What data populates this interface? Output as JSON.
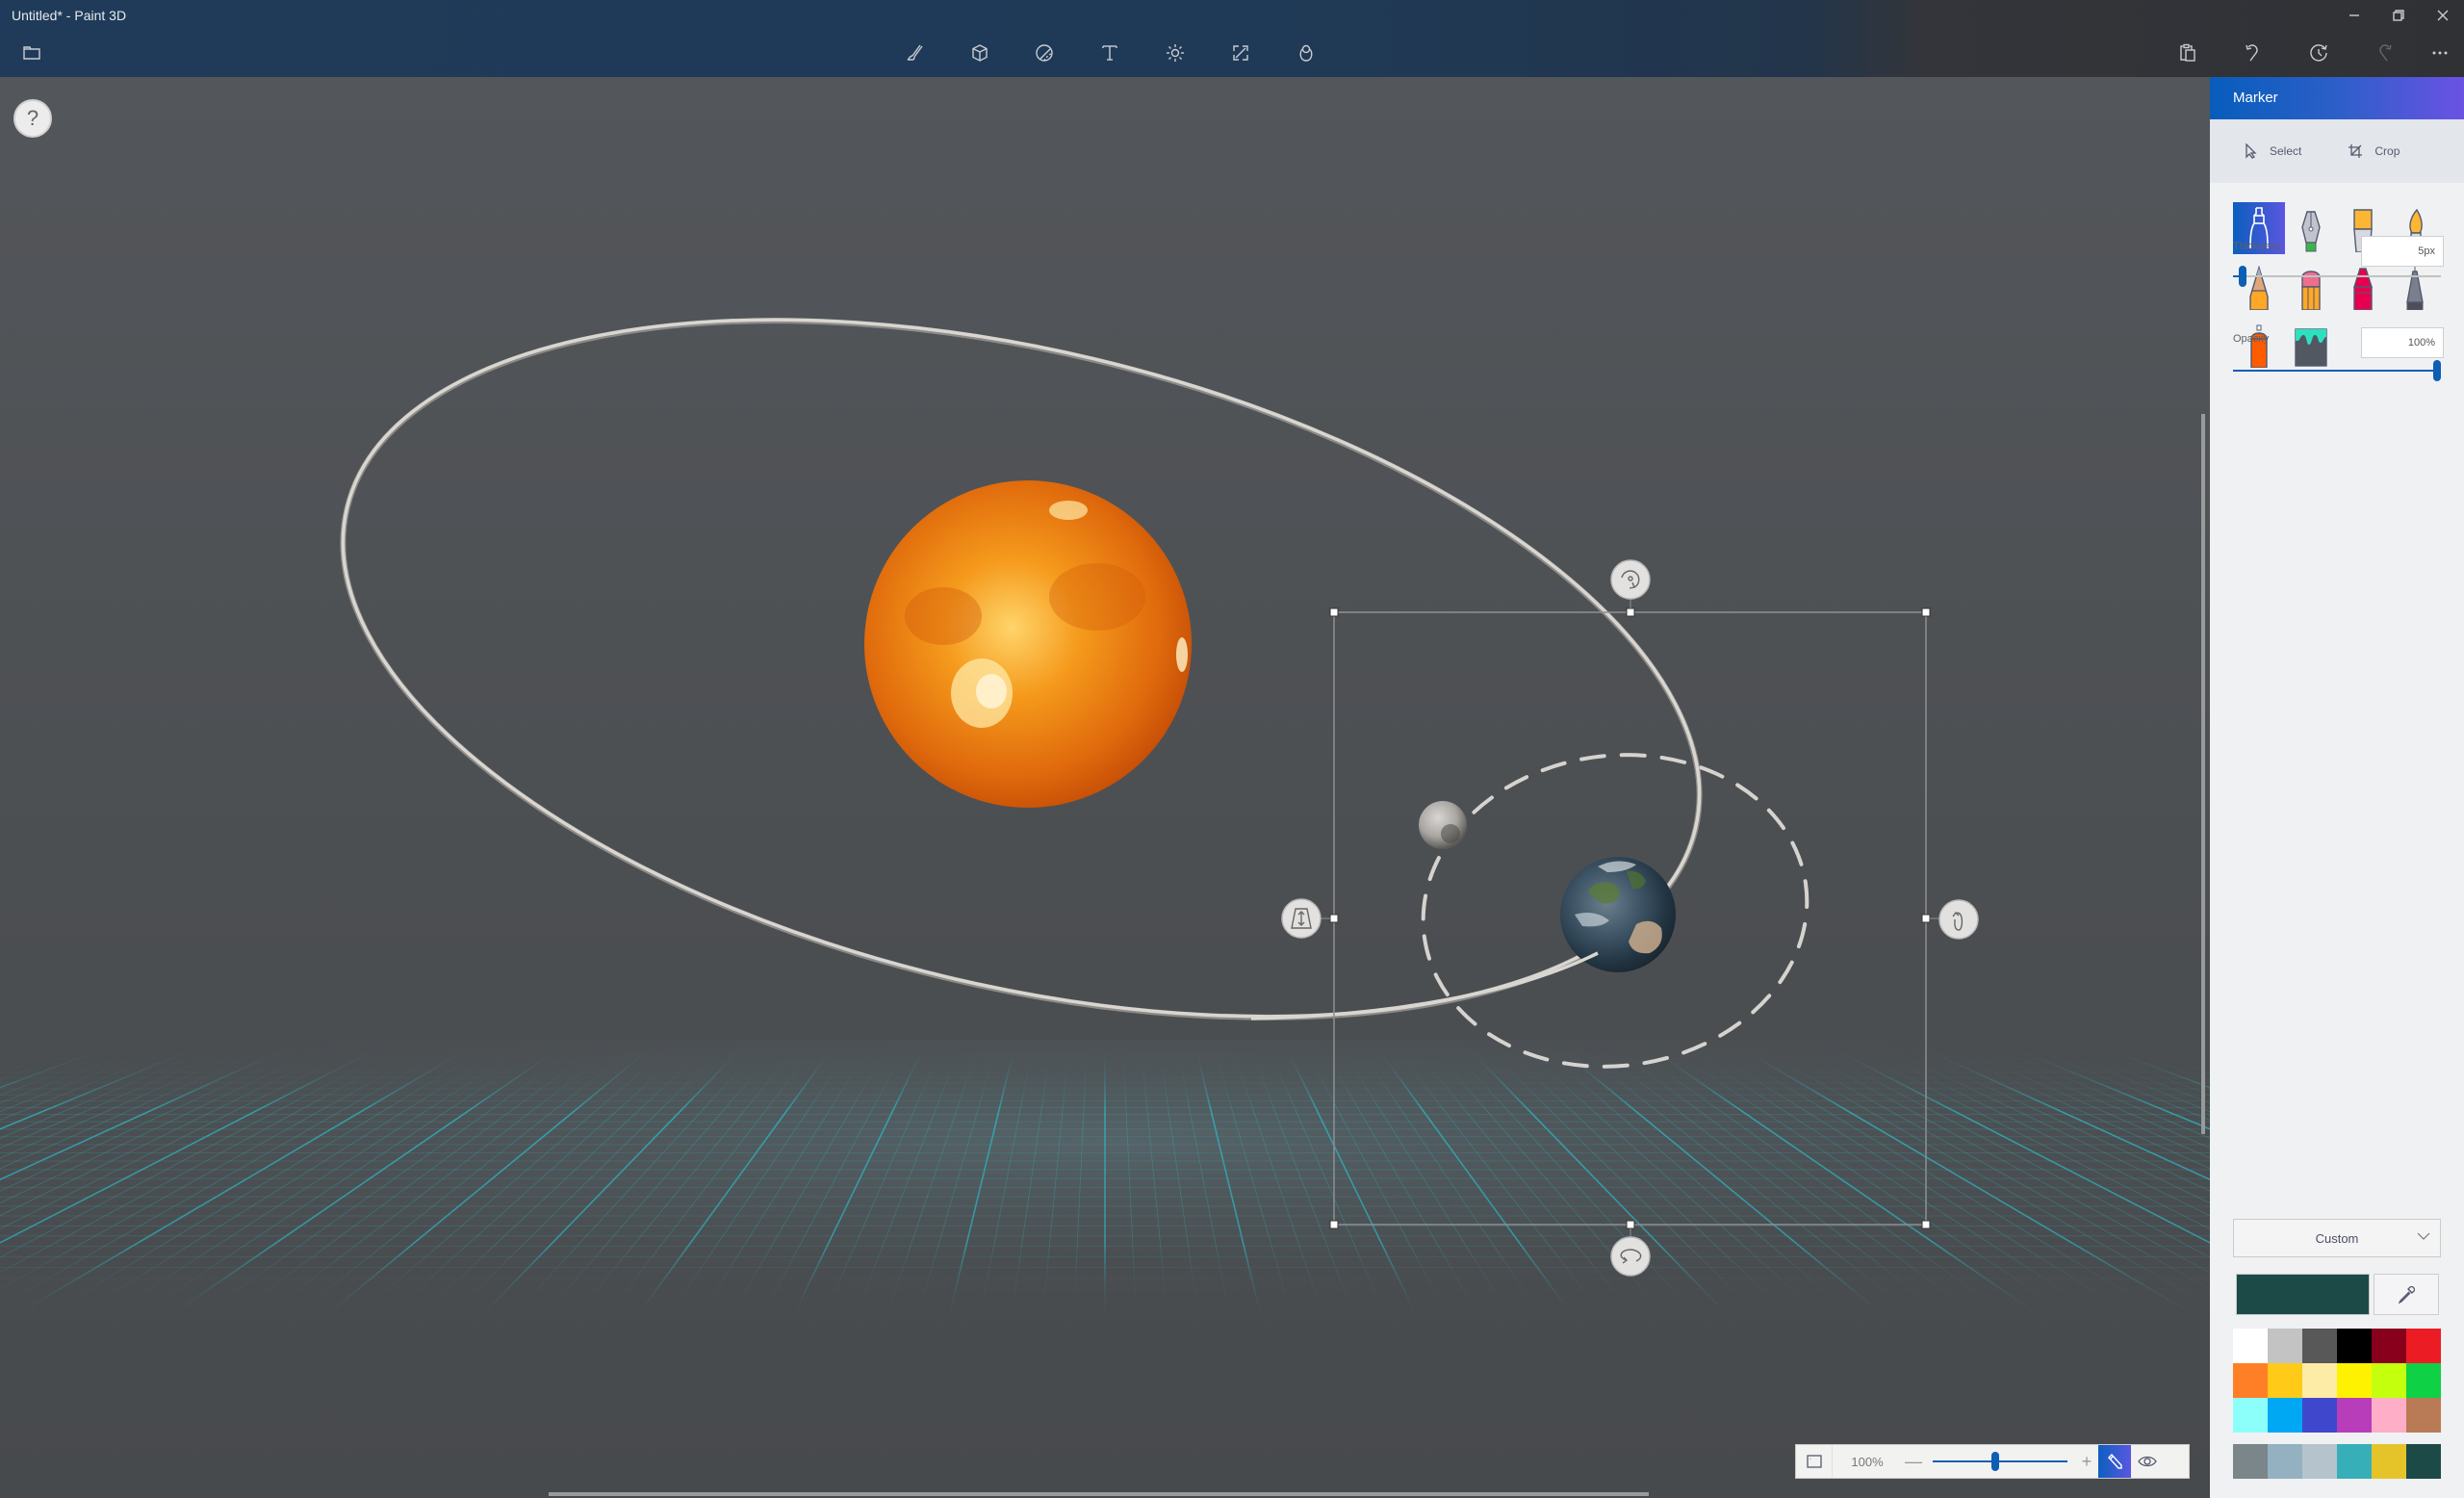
{
  "window": {
    "title": "Untitled* - Paint 3D",
    "controls": [
      "minimize",
      "restore",
      "close"
    ]
  },
  "toolbar": {
    "left": [
      {
        "name": "menu",
        "icon": "folder-icon"
      }
    ],
    "center": [
      {
        "name": "brushes",
        "icon": "brush-icon"
      },
      {
        "name": "3d-shapes",
        "icon": "cube-icon"
      },
      {
        "name": "stickers",
        "icon": "sticker-icon"
      },
      {
        "name": "text",
        "icon": "text-icon"
      },
      {
        "name": "effects",
        "icon": "effects-icon"
      },
      {
        "name": "canvas",
        "icon": "canvas-icon"
      },
      {
        "name": "3d-library",
        "icon": "3d-library-icon"
      }
    ],
    "right": [
      {
        "name": "paste",
        "icon": "paste-icon",
        "enabled": true
      },
      {
        "name": "undo",
        "icon": "undo-icon",
        "enabled": true
      },
      {
        "name": "history",
        "icon": "history-icon",
        "enabled": true
      },
      {
        "name": "redo",
        "icon": "redo-icon",
        "enabled": false
      },
      {
        "name": "more",
        "icon": "more-icon",
        "enabled": true
      }
    ]
  },
  "canvas": {
    "help_label": "?",
    "objects": [
      "sun",
      "earth",
      "moon",
      "earth-orbit",
      "moon-orbit"
    ],
    "selection_handles": [
      "rotate-z",
      "tilt",
      "rotate-y",
      "rotate-x"
    ]
  },
  "zoom_bar": {
    "zoom_label": "100%",
    "zoom_fraction": 0.46,
    "minus": "—",
    "plus": "+",
    "modes": [
      "edit",
      "view"
    ],
    "active_mode": "edit"
  },
  "panel": {
    "title": "Marker",
    "select_label": "Select",
    "crop_label": "Crop",
    "tools": [
      {
        "name": "marker",
        "selected": true
      },
      {
        "name": "calligraphy-pen",
        "selected": false
      },
      {
        "name": "oil-brush",
        "selected": false
      },
      {
        "name": "watercolor",
        "selected": false
      },
      {
        "name": "pixel-pen",
        "selected": false
      },
      {
        "name": "pencil",
        "selected": false
      },
      {
        "name": "eraser",
        "selected": false
      },
      {
        "name": "crayon",
        "selected": false
      },
      {
        "name": "spray-can",
        "selected": false
      },
      {
        "name": "fill",
        "selected": false
      }
    ],
    "thickness": {
      "label": "Thickness",
      "value": "5px",
      "fraction": 0.03
    },
    "opacity": {
      "label": "Opacity",
      "value": "100%",
      "fraction": 1.0
    },
    "color_mode": "Custom",
    "current_color": "#1b4a47",
    "palette": [
      "#ffffff",
      "#c3c3c3",
      "#585858",
      "#000000",
      "#88001b",
      "#ec1c24",
      "#ff7f27",
      "#ffca18",
      "#fdeca6",
      "#fff200",
      "#c4ff0e",
      "#0ed145",
      "#8cfffb",
      "#00a8f3",
      "#3f48cc",
      "#b83dba",
      "#ffaec8",
      "#b97a56"
    ],
    "custom_palette": [
      "#7a868a",
      "#93b1c1",
      "#b5c4cc",
      "#37afb9",
      "#e5c42a",
      "#1b4a47"
    ]
  },
  "accent_colors": {
    "brand_gradient_start": "#075dbc",
    "brand_gradient_end": "#6a52e4",
    "slider": "#0c5fb4",
    "grid": "#2fb6c4"
  }
}
